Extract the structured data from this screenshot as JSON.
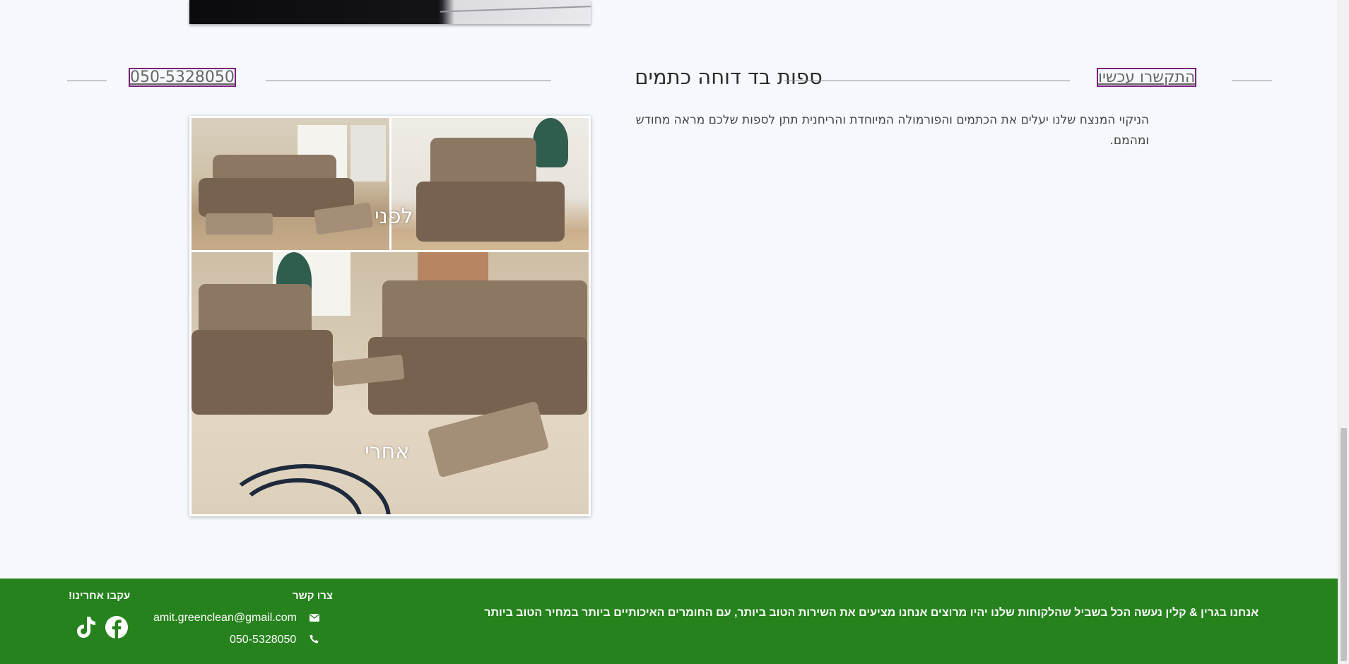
{
  "section": {
    "title": "ספות בד דוחה כתמים",
    "contact_now_link": "התקשרו עכשיו",
    "phone_link": "050-5328050",
    "description": "הניקוי המנצח שלנו יעלים את הכתמים והפורמולה המיוחדת והריחנית תתן לספות שלכם מראה מחודש ומהמם."
  },
  "collage": {
    "label_before": "לפני",
    "label_after": "אחרי"
  },
  "footer": {
    "tagline": "אנחנו בגרין & קלין נעשה הכל בשביל שהלקוחות שלנו יהיו מרוצים אנחנו מציעים את השירות הטוב ביותר, עם החומרים האיכותיים ביותר במחיר הטוב ביותר",
    "contact_title": "צרו קשר",
    "email": "amit.greenclean@gmail.com",
    "phone": "050-5328050",
    "follow_title": "עקבו אחרינו!",
    "icons": {
      "email": "envelope-icon",
      "phone": "phone-icon",
      "facebook": "facebook-icon",
      "tiktok": "tiktok-icon"
    },
    "background_color": "#26821d"
  }
}
